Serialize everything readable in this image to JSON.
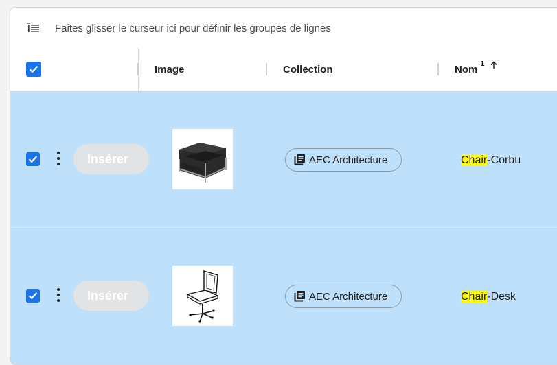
{
  "group_bar": {
    "placeholder": "Faites glisser le curseur ici pour définir les groupes de lignes",
    "icon": "list-indent-icon"
  },
  "header": {
    "columns": [
      {
        "label": "Image"
      },
      {
        "label": "Collection"
      },
      {
        "label": "Nom",
        "sort_index": "1",
        "sort_dir_icon": "arrow-up-icon"
      }
    ]
  },
  "rows": [
    {
      "selected": true,
      "insert_label": "Insérer",
      "collection": "AEC Architecture",
      "name_match": "Chair",
      "name_rest": "-Corbu",
      "thumbnail": "armchair"
    },
    {
      "selected": true,
      "insert_label": "Insérer",
      "collection": "AEC Architecture",
      "name_match": "Chair",
      "name_rest": "-Desk",
      "thumbnail": "desk-chair"
    }
  ],
  "colors": {
    "accent": "#1a73e8",
    "row_selected": "#bee0fb",
    "highlight": "#fffb00"
  }
}
